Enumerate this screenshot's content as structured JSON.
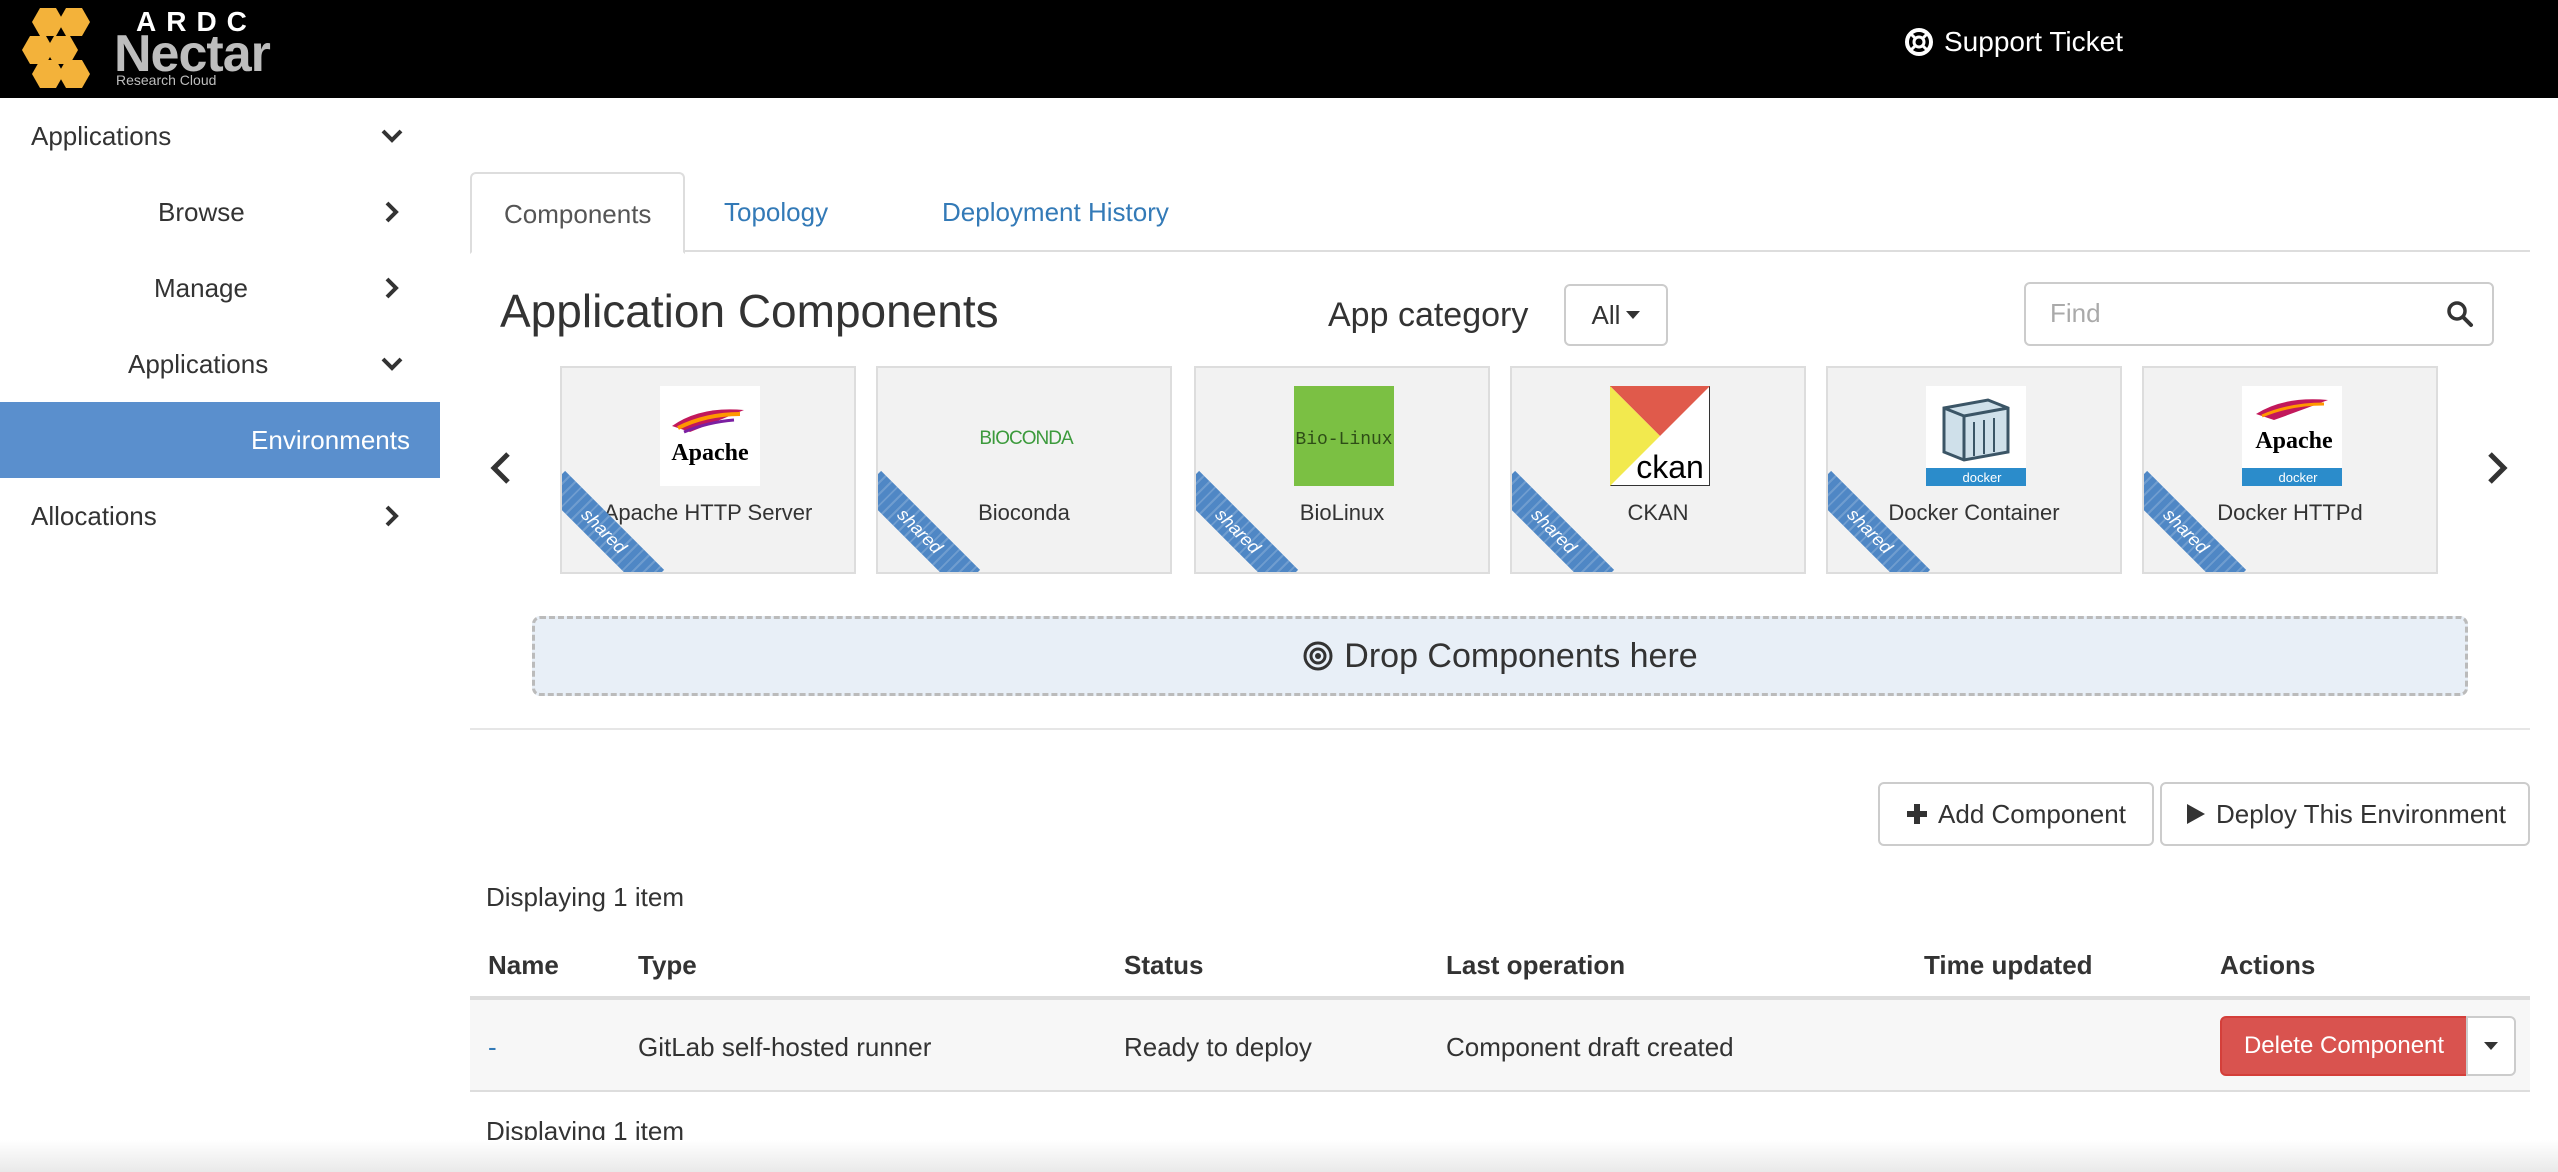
{
  "header": {
    "logo_ardc": "ARDC",
    "logo_name": "Nectar",
    "logo_sub": "Research Cloud",
    "support_label": "Support Ticket"
  },
  "sidebar": {
    "items": [
      {
        "label": "Applications",
        "chevron": "chevron-down-icon"
      },
      {
        "label": "Browse",
        "chevron": "chevron-right-icon"
      },
      {
        "label": "Manage",
        "chevron": "chevron-right-icon"
      },
      {
        "label": "Applications",
        "chevron": "chevron-down-icon"
      },
      {
        "label": "Environments",
        "active": true
      },
      {
        "label": "Allocations",
        "chevron": "chevron-right-icon"
      }
    ]
  },
  "tabs": [
    {
      "label": "Components",
      "active": true
    },
    {
      "label": "Topology"
    },
    {
      "label": "Deployment History"
    }
  ],
  "components_panel": {
    "title": "Application Components",
    "category_label": "App category",
    "category_value": "All",
    "search_placeholder": "Find",
    "ribbon_text": "shared",
    "cards": [
      {
        "name": "Apache HTTP Server",
        "icon": "apache-feather-icon"
      },
      {
        "name": "Bioconda",
        "icon": "bioconda-logo",
        "logo_text": "BIOCONDA"
      },
      {
        "name": "BioLinux",
        "icon": "biolinux-logo",
        "logo_text": "Bio-Linux"
      },
      {
        "name": "CKAN",
        "icon": "ckan-logo",
        "logo_text": "ckan"
      },
      {
        "name": "Docker Container",
        "icon": "docker-container-icon",
        "logo_text": "docker"
      },
      {
        "name": "Docker HTTPd",
        "icon": "apache-docker-icon",
        "logo_text": "Apache",
        "logo_sub": "docker"
      }
    ],
    "drop_label": "Drop Components here"
  },
  "actions": {
    "add_label": "Add Component",
    "deploy_label": "Deploy This Environment"
  },
  "table": {
    "count_top": "Displaying 1 item",
    "count_bottom": "Displaying 1 item",
    "headers": [
      "Name",
      "Type",
      "Status",
      "Last operation",
      "Time updated",
      "Actions"
    ],
    "rows": [
      {
        "name": "-",
        "type": "GitLab self-hosted runner",
        "status": "Ready to deploy",
        "last_operation": "Component draft created",
        "time_updated": "",
        "action_label": "Delete Component"
      }
    ]
  },
  "colors": {
    "active_nav": "#5a8fcd",
    "link": "#337ab7",
    "danger": "#d9534f",
    "ribbon": "#4f87c5"
  }
}
